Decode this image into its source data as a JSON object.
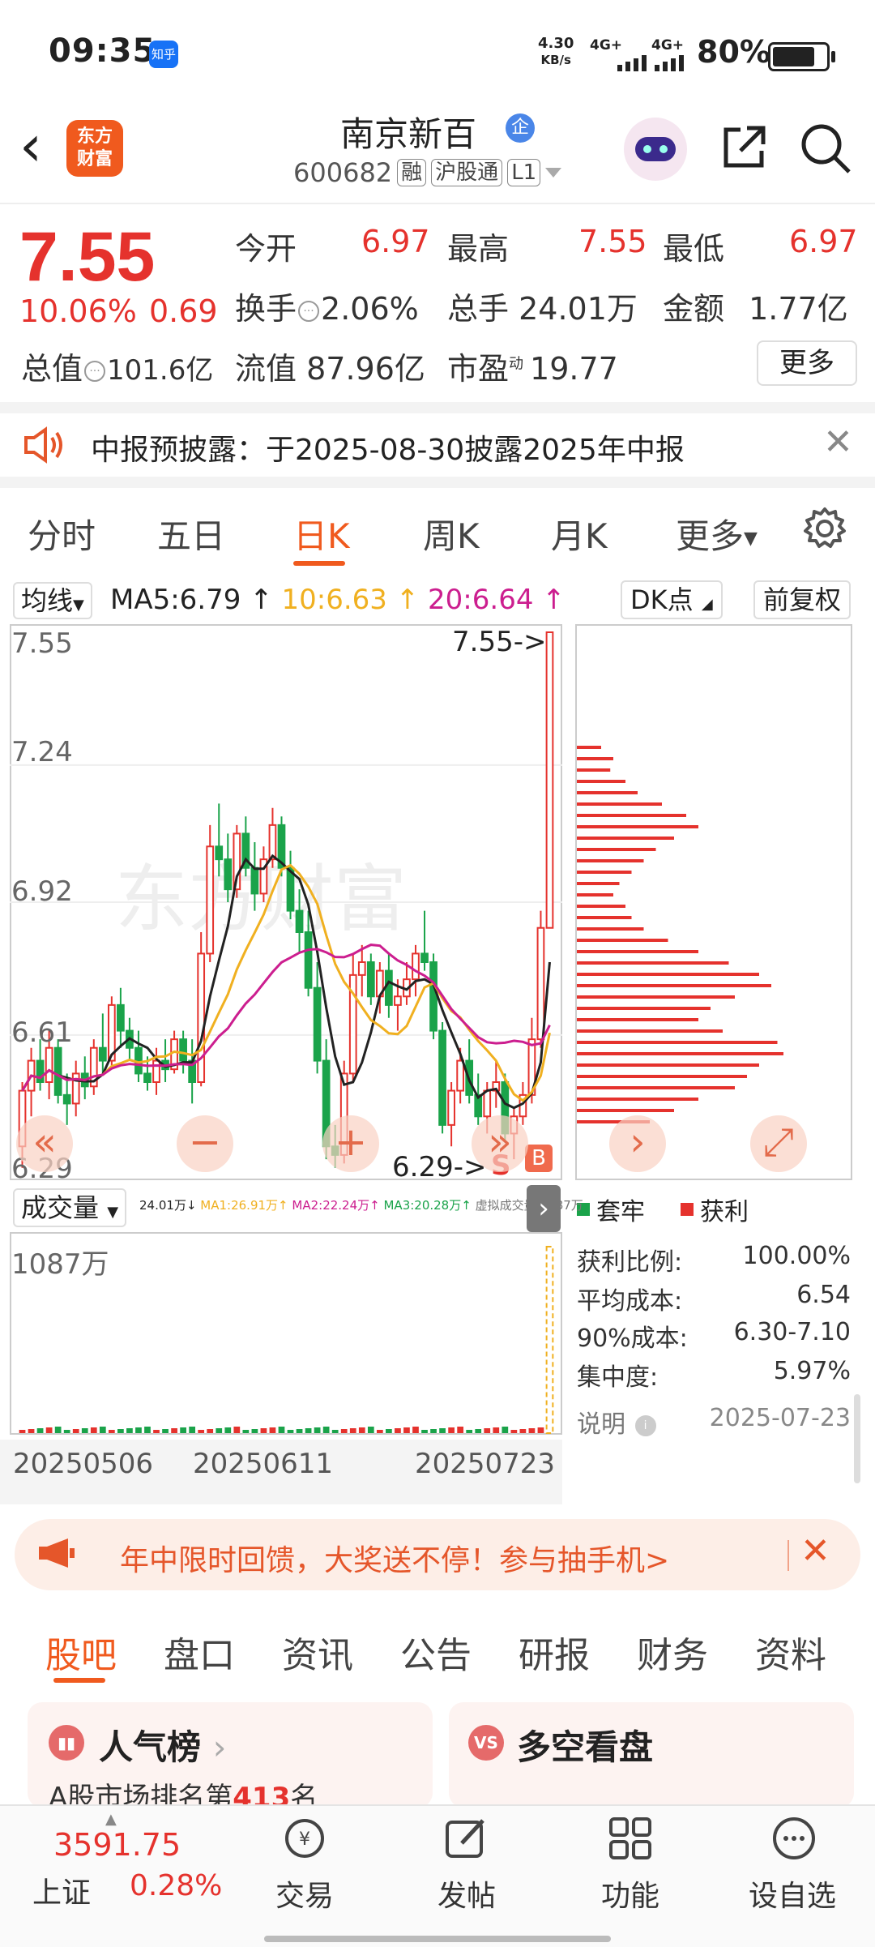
{
  "status_bar": {
    "time": "09:35",
    "notif_app": "知乎",
    "net_speed_top": "4.30",
    "net_speed_unit": "KB/s",
    "signal1": "4G+",
    "signal2": "4G+",
    "battery_pct": "80%",
    "battery_level": 0.8
  },
  "header": {
    "stock_name": "南京新百",
    "badge": "企",
    "code": "600682",
    "tags": [
      "融",
      "沪股通",
      "L1"
    ],
    "logo_line1": "东方",
    "logo_line2": "财富"
  },
  "quote": {
    "price": "7.55",
    "change_pct": "10.06%",
    "change_amt": "0.69",
    "open_label": "今开",
    "open": "6.97",
    "high_label": "最高",
    "high": "7.55",
    "low_label": "最低",
    "low": "6.97",
    "turnover_label": "换手",
    "turnover": "2.06%",
    "volume_label": "总手",
    "volume": "24.01万",
    "amount_label": "金额",
    "amount": "1.77亿",
    "mktcap_label": "总值",
    "mktcap": "101.6亿",
    "float_label": "流值",
    "float_cap": "87.96亿",
    "pe_label": "市盈",
    "pe_sup": "动",
    "pe": "19.77",
    "more": "更多"
  },
  "notice": {
    "text": "中报预披露：于2025-08-30披露2025年中报"
  },
  "chart_tabs": [
    "分时",
    "五日",
    "日K",
    "周K",
    "月K",
    "更多"
  ],
  "ma": {
    "selector": "均线",
    "ma5": "MA5:6.79",
    "ma10": "10:6.63",
    "ma20": "20:6.64",
    "dk": "DK点",
    "fq": "前复权"
  },
  "kchart": {
    "y_labels": [
      "7.55",
      "7.24",
      "6.92",
      "6.61",
      "6.29"
    ],
    "high_marker": "7.55->",
    "low_marker": "6.29->",
    "s_mark": "S",
    "b_mark": "B"
  },
  "volume": {
    "selector": "成交量",
    "legend_vol": "24.01万↓",
    "legend_ma1": "MA1:26.91万↑",
    "legend_ma2": "MA2:22.24万↑",
    "legend_ma3": "MA3:20.28万↑",
    "legend_virtual": "虚拟成交量:1087万",
    "max_label": "1087万",
    "dates": [
      "20250506",
      "20250611",
      "20250723"
    ]
  },
  "chip": {
    "legend_trapped": "套牢",
    "legend_profit": "获利",
    "rows": [
      {
        "label": "获利比例:",
        "value": "100.00%"
      },
      {
        "label": "平均成本:",
        "value": "6.54"
      },
      {
        "label": "90%成本:",
        "value": "6.30-7.10"
      },
      {
        "label": "集中度:",
        "value": "5.97%"
      }
    ],
    "explain": "说明",
    "date": "2025-07-23"
  },
  "promo": {
    "text": "年中限时回馈，大奖送不停！参与抽手机>"
  },
  "bottom_tabs": [
    "股吧",
    "盘口",
    "资讯",
    "公告",
    "研报",
    "财务",
    "资料"
  ],
  "cards": {
    "card1_title": "人气榜",
    "card1_sub_pre": "A股市场排名第",
    "card1_rank": "413",
    "card1_sub_post": "名",
    "card2_icon": "VS",
    "card2_title": "多空看盘"
  },
  "bottom_bar": {
    "index_value": "3591.75",
    "index_name": "上证",
    "index_pct": "0.28%",
    "items": [
      "交易",
      "发帖",
      "功能",
      "设自选"
    ]
  },
  "colors": {
    "up": "#e5322d",
    "down": "#1aa34a",
    "ma5": "#222222",
    "ma10": "#f0b020",
    "ma20": "#cc1e8f",
    "accent": "#f05a1e"
  },
  "chart_data": {
    "type": "candlestick",
    "ylim": [
      6.29,
      7.55
    ],
    "ohlc": [
      [
        6.35,
        6.5,
        6.3,
        6.48
      ],
      [
        6.48,
        6.58,
        6.42,
        6.55
      ],
      [
        6.55,
        6.6,
        6.48,
        6.5
      ],
      [
        6.5,
        6.62,
        6.46,
        6.58
      ],
      [
        6.58,
        6.6,
        6.45,
        6.47
      ],
      [
        6.47,
        6.52,
        6.4,
        6.45
      ],
      [
        6.45,
        6.55,
        6.42,
        6.52
      ],
      [
        6.52,
        6.56,
        6.46,
        6.49
      ],
      [
        6.49,
        6.6,
        6.47,
        6.58
      ],
      [
        6.58,
        6.66,
        6.52,
        6.55
      ],
      [
        6.55,
        6.7,
        6.53,
        6.68
      ],
      [
        6.68,
        6.72,
        6.58,
        6.62
      ],
      [
        6.62,
        6.65,
        6.55,
        6.58
      ],
      [
        6.58,
        6.62,
        6.5,
        6.52
      ],
      [
        6.52,
        6.56,
        6.48,
        6.5
      ],
      [
        6.5,
        6.58,
        6.47,
        6.55
      ],
      [
        6.55,
        6.6,
        6.5,
        6.53
      ],
      [
        6.53,
        6.62,
        6.52,
        6.6
      ],
      [
        6.6,
        6.62,
        6.52,
        6.55
      ],
      [
        6.55,
        6.6,
        6.45,
        6.5
      ],
      [
        6.5,
        6.85,
        6.49,
        6.8
      ],
      [
        6.8,
        7.1,
        6.78,
        7.05
      ],
      [
        7.05,
        7.15,
        6.98,
        7.02
      ],
      [
        7.02,
        7.08,
        6.92,
        6.95
      ],
      [
        6.95,
        7.1,
        6.93,
        7.08
      ],
      [
        7.08,
        7.12,
        6.98,
        7.0
      ],
      [
        7.0,
        7.06,
        6.9,
        6.94
      ],
      [
        6.94,
        7.05,
        6.92,
        7.02
      ],
      [
        7.02,
        7.14,
        7.0,
        7.1
      ],
      [
        7.1,
        7.12,
        6.98,
        7.0
      ],
      [
        7.0,
        7.04,
        6.88,
        6.9
      ],
      [
        6.9,
        6.95,
        6.8,
        6.85
      ],
      [
        6.85,
        6.9,
        6.7,
        6.72
      ],
      [
        6.72,
        6.78,
        6.52,
        6.55
      ],
      [
        6.55,
        6.6,
        6.32,
        6.35
      ],
      [
        6.35,
        6.4,
        6.3,
        6.33
      ],
      [
        6.33,
        6.55,
        6.31,
        6.52
      ],
      [
        6.52,
        6.8,
        6.5,
        6.75
      ],
      [
        6.75,
        6.82,
        6.7,
        6.78
      ],
      [
        6.78,
        6.8,
        6.68,
        6.7
      ],
      [
        6.7,
        6.78,
        6.66,
        6.76
      ],
      [
        6.76,
        6.8,
        6.65,
        6.68
      ],
      [
        6.68,
        6.74,
        6.62,
        6.7
      ],
      [
        6.7,
        6.78,
        6.68,
        6.74
      ],
      [
        6.74,
        6.82,
        6.7,
        6.8
      ],
      [
        6.8,
        6.9,
        6.76,
        6.78
      ],
      [
        6.78,
        6.8,
        6.6,
        6.62
      ],
      [
        6.62,
        6.64,
        6.38,
        6.4
      ],
      [
        6.4,
        6.5,
        6.35,
        6.48
      ],
      [
        6.48,
        6.58,
        6.45,
        6.55
      ],
      [
        6.55,
        6.6,
        6.45,
        6.47
      ],
      [
        6.47,
        6.52,
        6.4,
        6.42
      ],
      [
        6.42,
        6.5,
        6.38,
        6.48
      ],
      [
        6.48,
        6.55,
        6.44,
        6.5
      ],
      [
        6.5,
        6.52,
        6.36,
        6.38
      ],
      [
        6.38,
        6.44,
        6.32,
        6.42
      ],
      [
        6.42,
        6.5,
        6.4,
        6.47
      ],
      [
        6.47,
        6.65,
        6.45,
        6.6
      ],
      [
        6.6,
        6.9,
        6.58,
        6.86
      ],
      [
        6.86,
        7.55,
        6.86,
        7.55
      ]
    ]
  }
}
